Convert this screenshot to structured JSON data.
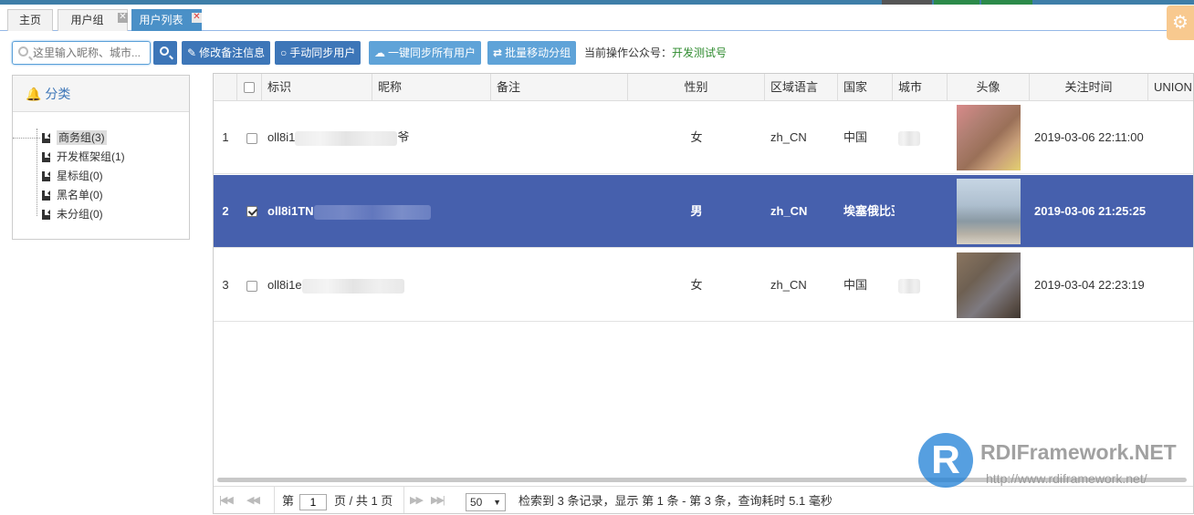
{
  "tabs": [
    {
      "label": "主页",
      "closable": false
    },
    {
      "label": "用户组",
      "closable": true
    },
    {
      "label": "用户列表",
      "closable": true,
      "active": true
    }
  ],
  "toolbar": {
    "search_placeholder": "这里输入昵称、城市...",
    "edit_note": "修改备注信息",
    "manual_sync": "手动同步用户",
    "sync_all": "一键同步所有用户",
    "batch_move": "批量移动分组",
    "account_label": "当前操作公众号：",
    "account_value": "开发测试号"
  },
  "sidebar": {
    "title": "分类",
    "groups": [
      {
        "label": "商务组(3)",
        "selected": true
      },
      {
        "label": "开发框架组(1)"
      },
      {
        "label": "星标组(0)"
      },
      {
        "label": "黑名单(0)"
      },
      {
        "label": "未分组(0)"
      }
    ]
  },
  "grid": {
    "columns": [
      "标识",
      "昵称",
      "备注",
      "性别",
      "区域语言",
      "国家",
      "城市",
      "头像",
      "关注时间",
      "UNION"
    ],
    "rows": [
      {
        "index": "1",
        "checked": false,
        "id": "oll8i1",
        "id_tail": "爷",
        "gender": "女",
        "lang": "zh_CN",
        "country": "中国",
        "subscribe_time": "2019-03-06 22:11:00"
      },
      {
        "index": "2",
        "checked": true,
        "id": "oll8i1TN",
        "id_tail": "",
        "gender": "男",
        "lang": "zh_CN",
        "country": "埃塞俄比亚",
        "subscribe_time": "2019-03-06 21:25:25"
      },
      {
        "index": "3",
        "checked": false,
        "id": "oll8i1e",
        "id_tail": "",
        "gender": "女",
        "lang": "zh_CN",
        "country": "中国",
        "subscribe_time": "2019-03-04 22:23:19"
      }
    ]
  },
  "pager": {
    "page_prefix": "第",
    "page_value": "1",
    "page_suffix": "页 / 共 1 页",
    "page_size": "50",
    "summary": "检索到 3 条记录，显示 第 1 条 - 第 3 条，查询耗时 5.1 毫秒"
  },
  "watermark": {
    "logo_letter": "R",
    "name": "RDIFramework.NET",
    "url": "http://www.rdiframework.net/"
  },
  "colors": {
    "accent": "#3d76b8",
    "selected_row": "#4660ad",
    "account_value": "#2e8b2e"
  }
}
